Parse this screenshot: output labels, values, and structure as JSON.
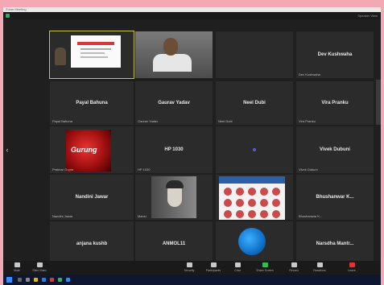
{
  "window": {
    "title": "Zoom Meeting",
    "view_label": "Speaker View"
  },
  "meeting_info": "",
  "tiles": [
    {
      "id": "presenter",
      "name": "",
      "caption": ""
    },
    {
      "id": "cam",
      "name": "",
      "caption": ""
    },
    {
      "id": "blank1",
      "name": "",
      "caption": ""
    },
    {
      "id": "c1",
      "name": "Dev Kushwaha",
      "caption": "Dev Kushwaha"
    },
    {
      "id": "r1",
      "name": "Payal Bahuna",
      "caption": "Payal Bahuna"
    },
    {
      "id": "r2",
      "name": "Gaurav Yadav",
      "caption": "Gaurav Yadav"
    },
    {
      "id": "r3",
      "name": "Neel Dubi",
      "caption": "Neel Dubi"
    },
    {
      "id": "r4",
      "name": "Vira Pranku",
      "caption": "Vira Pranku"
    },
    {
      "id": "logo",
      "name": "",
      "caption": "Prakhar Gupta"
    },
    {
      "id": "hp",
      "name": "HP 1030",
      "caption": "HP 1030"
    },
    {
      "id": "dot",
      "name": "",
      "caption": ""
    },
    {
      "id": "vivek",
      "name": "Vivek Dubuni",
      "caption": "Vivek Dubuni"
    },
    {
      "id": "nandini",
      "name": "Nandini Jawar",
      "caption": "Nandini Jawar"
    },
    {
      "id": "portrait",
      "name": "",
      "caption": "Mansi"
    },
    {
      "id": "poster",
      "name": "",
      "caption": ""
    },
    {
      "id": "bhushan",
      "name": "Bhushanwar K...",
      "caption": "Bhushanwar K..."
    },
    {
      "id": "anjana",
      "name": "anjana kushb",
      "caption": "anjana kushb"
    },
    {
      "id": "anmol",
      "name": "ANMOL11",
      "caption": "ANMOL11"
    },
    {
      "id": "globe",
      "name": "",
      "caption": ""
    },
    {
      "id": "narsa",
      "name": "Narsdha Mantr...",
      "caption": "Narsdha Mantr..."
    }
  ],
  "toolbar": [
    {
      "label": "Mute",
      "icon": "mic-icon"
    },
    {
      "label": "Start Video",
      "icon": "video-icon"
    },
    {
      "label": "Security",
      "icon": "shield-icon"
    },
    {
      "label": "Participants",
      "icon": "participants-icon"
    },
    {
      "label": "Chat",
      "icon": "chat-icon"
    },
    {
      "label": "Share Screen",
      "icon": "share-screen-icon"
    },
    {
      "label": "Record",
      "icon": "record-icon"
    },
    {
      "label": "Reactions",
      "icon": "reactions-icon"
    },
    {
      "label": "Leave",
      "icon": "leave-icon"
    }
  ],
  "slide": {
    "heading": ""
  },
  "logo_text": "Gurung"
}
